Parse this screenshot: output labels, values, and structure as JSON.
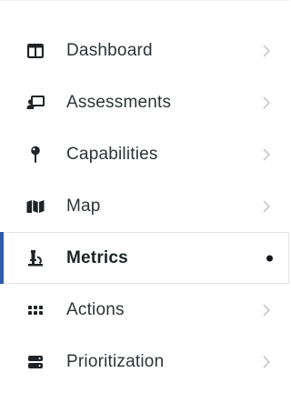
{
  "nav": {
    "items": [
      {
        "label": "Dashboard",
        "icon": "columns-icon",
        "active": false
      },
      {
        "label": "Assessments",
        "icon": "chalkboard-teacher-icon",
        "active": false
      },
      {
        "label": "Capabilities",
        "icon": "map-pin-icon",
        "active": false
      },
      {
        "label": "Map",
        "icon": "folded-map-icon",
        "active": false
      },
      {
        "label": "Metrics",
        "icon": "microscope-icon",
        "active": true
      },
      {
        "label": "Actions",
        "icon": "grid-dots-icon",
        "active": false
      },
      {
        "label": "Prioritization",
        "icon": "server-stack-icon",
        "active": false
      }
    ]
  },
  "colors": {
    "active_marker": "#2e5baa",
    "icon": "#1f2327",
    "chevron": "#c5c9ce",
    "text": "#2e3338"
  }
}
